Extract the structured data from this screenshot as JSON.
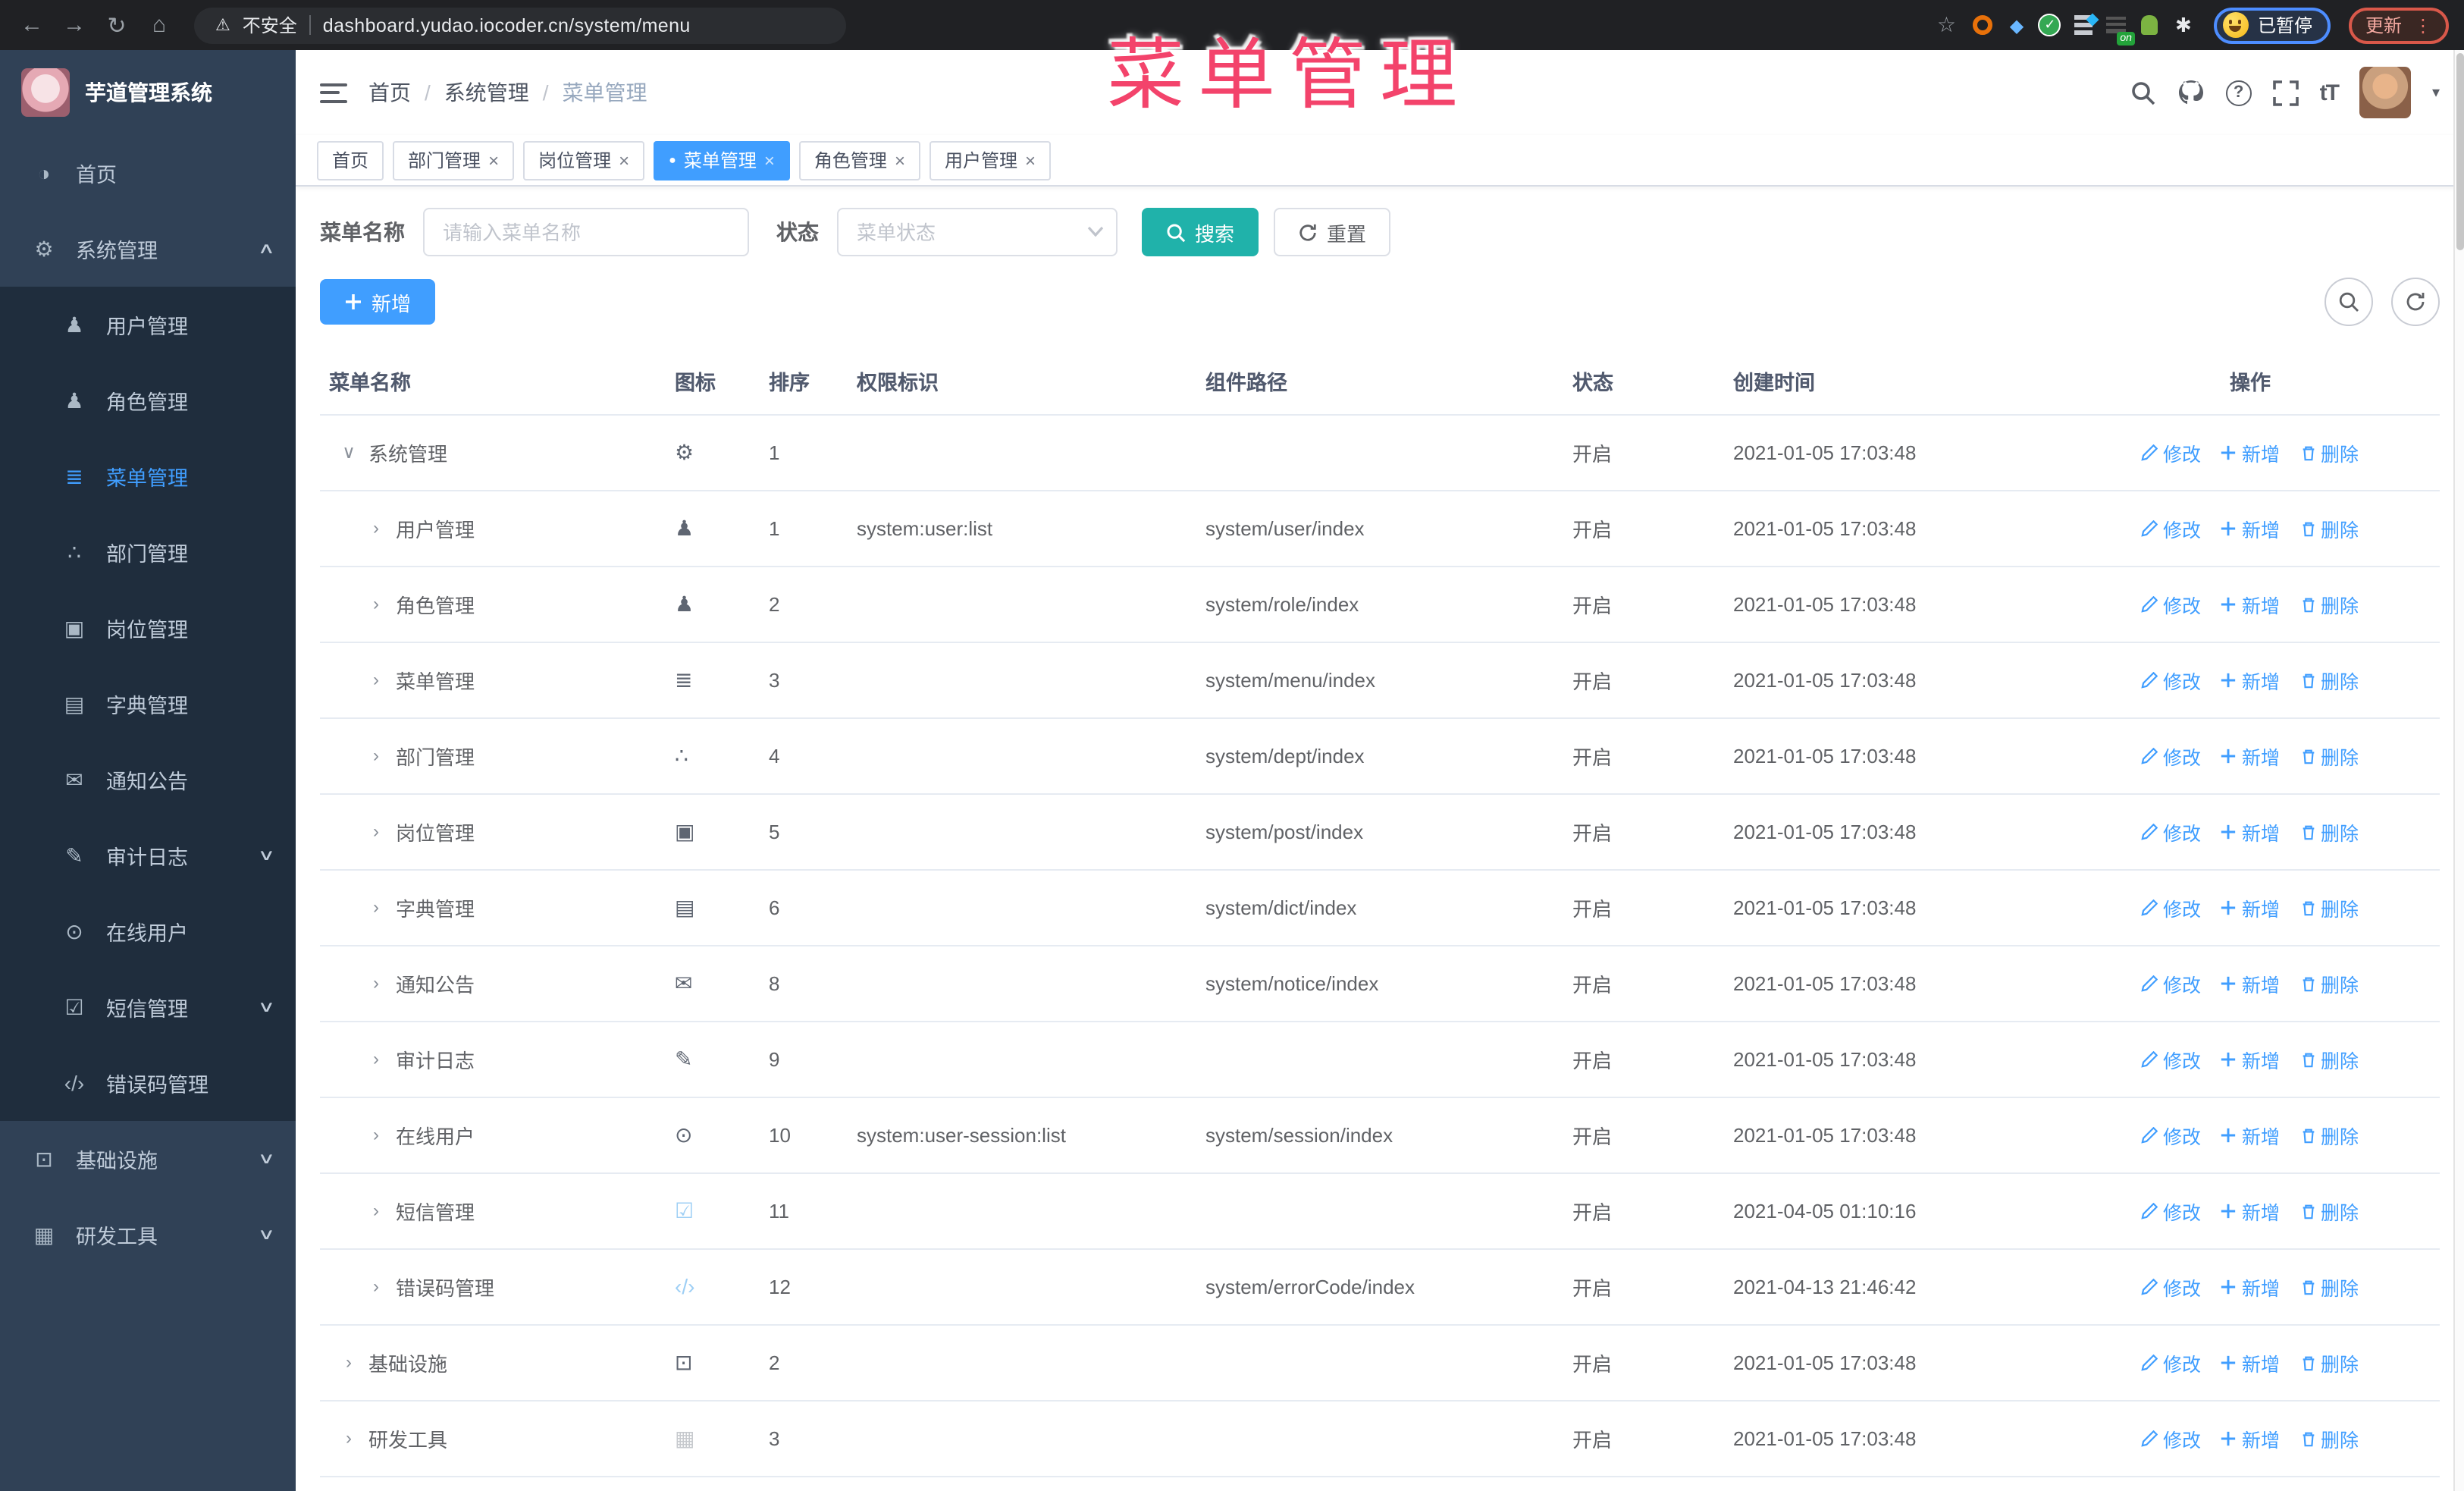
{
  "chrome": {
    "back_glyph": "←",
    "forward_glyph": "→",
    "reload_glyph": "↻",
    "home_glyph": "⌂",
    "warning_glyph": "⚠",
    "security_label": "不安全",
    "url": "dashboard.yudao.iocoder.cn/system/menu",
    "star_glyph": "☆",
    "gem_glyph": "◆",
    "check_glyph": "✓",
    "puzzle_glyph": "✱",
    "on_badge": "on",
    "paused_badge": "已暂停",
    "update_button": "更新",
    "menu_dots": "⋮"
  },
  "watermark": "菜单管理",
  "sidebar": {
    "title": "芋道管理系统",
    "items": [
      {
        "label": "首页",
        "icon": "dashboard-icon",
        "glyph": "◑",
        "level": "0",
        "state": "",
        "chevron": ""
      },
      {
        "label": "系统管理",
        "icon": "gear-icon",
        "glyph": "⚙",
        "level": "0",
        "state": "open",
        "chevron": "∧"
      },
      {
        "label": "用户管理",
        "icon": "user-icon",
        "glyph": "♟",
        "level": "1",
        "state": "",
        "chevron": ""
      },
      {
        "label": "角色管理",
        "icon": "role-users-icon",
        "glyph": "♟",
        "level": "1",
        "state": "",
        "chevron": ""
      },
      {
        "label": "菜单管理",
        "icon": "menu-list-icon",
        "glyph": "≣",
        "level": "1",
        "state": "active",
        "chevron": ""
      },
      {
        "label": "部门管理",
        "icon": "dept-tree-icon",
        "glyph": "∴",
        "level": "1",
        "state": "",
        "chevron": ""
      },
      {
        "label": "岗位管理",
        "icon": "post-badge-icon",
        "glyph": "▣",
        "level": "1",
        "state": "",
        "chevron": ""
      },
      {
        "label": "字典管理",
        "icon": "dict-book-icon",
        "glyph": "▤",
        "level": "1",
        "state": "",
        "chevron": ""
      },
      {
        "label": "通知公告",
        "icon": "notice-message-icon",
        "glyph": "✉",
        "level": "1",
        "state": "",
        "chevron": ""
      },
      {
        "label": "审计日志",
        "icon": "audit-log-icon",
        "glyph": "✎",
        "level": "1",
        "state": "",
        "chevron": "∨"
      },
      {
        "label": "在线用户",
        "icon": "online-user-icon",
        "glyph": "⊙",
        "level": "1",
        "state": "",
        "chevron": ""
      },
      {
        "label": "短信管理",
        "icon": "sms-shield-icon",
        "glyph": "☑",
        "level": "1",
        "state": "",
        "chevron": "∨"
      },
      {
        "label": "错误码管理",
        "icon": "error-code-icon",
        "glyph": "‹/›",
        "level": "1",
        "state": "",
        "chevron": ""
      },
      {
        "label": "基础设施",
        "icon": "infra-monitor-icon",
        "glyph": "⊡",
        "level": "0",
        "state": "",
        "chevron": "∨"
      },
      {
        "label": "研发工具",
        "icon": "devtools-toolbox-icon",
        "glyph": "▦",
        "level": "0",
        "state": "",
        "chevron": "∨"
      }
    ]
  },
  "header": {
    "breadcrumb": [
      {
        "label": "首页",
        "state": ""
      },
      {
        "label": "系统管理",
        "state": ""
      },
      {
        "label": "菜单管理",
        "state": "current"
      }
    ],
    "separator": "/",
    "help_glyph": "?",
    "fontsize_glyph": "tT",
    "caret_glyph": "▾"
  },
  "tabs": [
    {
      "label": "首页",
      "dot": "",
      "close": "",
      "state": ""
    },
    {
      "label": "部门管理",
      "dot": "",
      "close": "×",
      "state": ""
    },
    {
      "label": "岗位管理",
      "dot": "",
      "close": "×",
      "state": ""
    },
    {
      "label": "菜单管理",
      "dot": "●",
      "close": "×",
      "state": "active"
    },
    {
      "label": "角色管理",
      "dot": "",
      "close": "×",
      "state": ""
    },
    {
      "label": "用户管理",
      "dot": "",
      "close": "×",
      "state": ""
    }
  ],
  "filters": {
    "name_label": "菜单名称",
    "name_placeholder": "请输入菜单名称",
    "status_label": "状态",
    "status_placeholder": "菜单状态",
    "search_label": "搜索",
    "reset_label": "重置"
  },
  "toolbar": {
    "add_label": "新增"
  },
  "table": {
    "headers": [
      "菜单名称",
      "图标",
      "排序",
      "权限标识",
      "组件路径",
      "状态",
      "创建时间",
      "操作"
    ],
    "rows": [
      {
        "name": "系统管理",
        "arrow": "∨",
        "level": "0",
        "icon": "gear-icon",
        "glyph": "⚙",
        "tone": "",
        "order": "1",
        "perm": "",
        "path": "",
        "status": "开启",
        "time": "2021-01-05 17:03:48"
      },
      {
        "name": "用户管理",
        "arrow": "›",
        "level": "1",
        "icon": "user-icon",
        "glyph": "♟",
        "tone": "",
        "order": "1",
        "perm": "system:user:list",
        "path": "system/user/index",
        "status": "开启",
        "time": "2021-01-05 17:03:48"
      },
      {
        "name": "角色管理",
        "arrow": "›",
        "level": "1",
        "icon": "role-users-icon",
        "glyph": "♟",
        "tone": "",
        "order": "2",
        "perm": "",
        "path": "system/role/index",
        "status": "开启",
        "time": "2021-01-05 17:03:48"
      },
      {
        "name": "菜单管理",
        "arrow": "›",
        "level": "1",
        "icon": "menu-list-icon",
        "glyph": "≣",
        "tone": "",
        "order": "3",
        "perm": "",
        "path": "system/menu/index",
        "status": "开启",
        "time": "2021-01-05 17:03:48"
      },
      {
        "name": "部门管理",
        "arrow": "›",
        "level": "1",
        "icon": "dept-tree-icon",
        "glyph": "∴",
        "tone": "",
        "order": "4",
        "perm": "",
        "path": "system/dept/index",
        "status": "开启",
        "time": "2021-01-05 17:03:48"
      },
      {
        "name": "岗位管理",
        "arrow": "›",
        "level": "1",
        "icon": "post-badge-icon",
        "glyph": "▣",
        "tone": "",
        "order": "5",
        "perm": "",
        "path": "system/post/index",
        "status": "开启",
        "time": "2021-01-05 17:03:48"
      },
      {
        "name": "字典管理",
        "arrow": "›",
        "level": "1",
        "icon": "dict-book-icon",
        "glyph": "▤",
        "tone": "",
        "order": "6",
        "perm": "",
        "path": "system/dict/index",
        "status": "开启",
        "time": "2021-01-05 17:03:48"
      },
      {
        "name": "通知公告",
        "arrow": "›",
        "level": "1",
        "icon": "notice-message-icon",
        "glyph": "✉",
        "tone": "",
        "order": "8",
        "perm": "",
        "path": "system/notice/index",
        "status": "开启",
        "time": "2021-01-05 17:03:48"
      },
      {
        "name": "审计日志",
        "arrow": "›",
        "level": "1",
        "icon": "audit-log-icon",
        "glyph": "✎",
        "tone": "",
        "order": "9",
        "perm": "",
        "path": "",
        "status": "开启",
        "time": "2021-01-05 17:03:48"
      },
      {
        "name": "在线用户",
        "arrow": "›",
        "level": "1",
        "icon": "online-user-icon",
        "glyph": "⊙",
        "tone": "",
        "order": "10",
        "perm": "system:user-session:list",
        "path": "system/session/index",
        "status": "开启",
        "time": "2021-01-05 17:03:48"
      },
      {
        "name": "短信管理",
        "arrow": "›",
        "level": "1",
        "icon": "sms-shield-icon",
        "glyph": "☑",
        "tone": "light",
        "order": "11",
        "perm": "",
        "path": "",
        "status": "开启",
        "time": "2021-04-05 01:10:16"
      },
      {
        "name": "错误码管理",
        "arrow": "›",
        "level": "1",
        "icon": "error-code-icon",
        "glyph": "‹/›",
        "tone": "light",
        "order": "12",
        "perm": "",
        "path": "system/errorCode/index",
        "status": "开启",
        "time": "2021-04-13 21:46:42"
      },
      {
        "name": "基础设施",
        "arrow": "›",
        "level": "0",
        "icon": "infra-monitor-icon",
        "glyph": "⊡",
        "tone": "",
        "order": "2",
        "perm": "",
        "path": "",
        "status": "开启",
        "time": "2021-01-05 17:03:48"
      },
      {
        "name": "研发工具",
        "arrow": "›",
        "level": "0",
        "icon": "devtools-toolbox-icon",
        "glyph": "▦",
        "tone": "muted",
        "order": "3",
        "perm": "",
        "path": "",
        "status": "开启",
        "time": "2021-01-05 17:03:48"
      }
    ]
  },
  "row_actions": {
    "edit": "修改",
    "add": "新增",
    "del": "删除"
  }
}
